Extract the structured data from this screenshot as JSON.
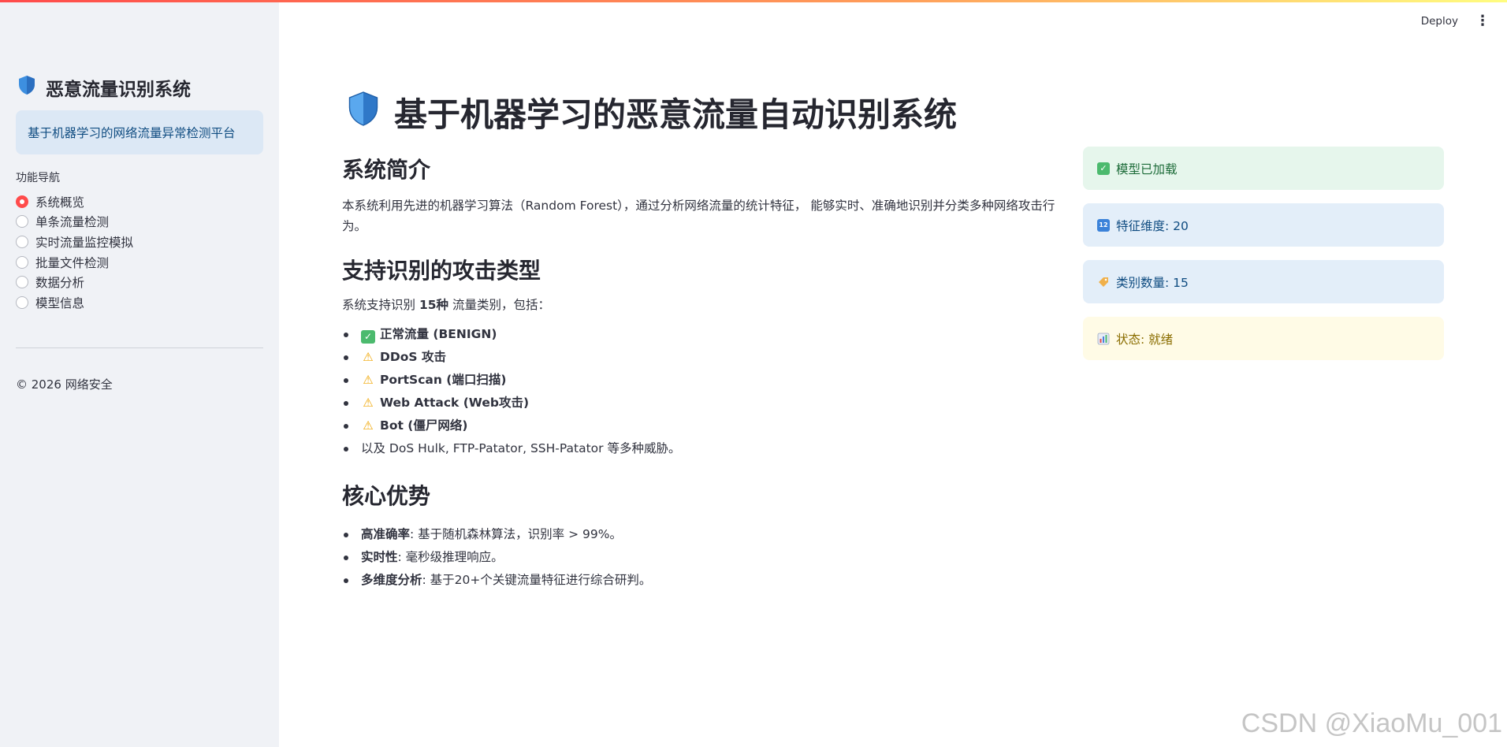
{
  "header": {
    "deploy_label": "Deploy",
    "menu_icon": "kebab-menu-icon"
  },
  "sidebar": {
    "title": "恶意流量识别系统",
    "title_icon": "shield-icon",
    "info_text": "基于机器学习的网络流量异常检测平台",
    "nav_label": "功能导航",
    "nav_items": [
      {
        "label": "系统概览",
        "selected": true
      },
      {
        "label": "单条流量检测",
        "selected": false
      },
      {
        "label": "实时流量监控模拟",
        "selected": false
      },
      {
        "label": "批量文件检测",
        "selected": false
      },
      {
        "label": "数据分析",
        "selected": false
      },
      {
        "label": "模型信息",
        "selected": false
      }
    ],
    "footer": "© 2026 网络安全"
  },
  "main": {
    "title": "基于机器学习的恶意流量自动识别系统",
    "sections": {
      "intro_heading": "系统简介",
      "intro_text": "本系统利用先进的机器学习算法（Random Forest），通过分析网络流量的统计特征， 能够实时、准确地识别并分类多种网络攻击行为。",
      "attack_heading": "支持识别的攻击类型",
      "attack_intro_prefix": "系统支持识别 ",
      "attack_intro_count": "15种",
      "attack_intro_suffix": " 流量类别，包括：",
      "attack_items": [
        {
          "icon": "check-icon",
          "text": "正常流量 (BENIGN)",
          "bold": true
        },
        {
          "icon": "warning-icon",
          "text": "DDoS 攻击",
          "bold": true
        },
        {
          "icon": "warning-icon",
          "text": "PortScan (端口扫描)",
          "bold": true
        },
        {
          "icon": "warning-icon",
          "text": "Web Attack (Web攻击)",
          "bold": true
        },
        {
          "icon": "warning-icon",
          "text": "Bot (僵尸网络)",
          "bold": true
        },
        {
          "icon": "",
          "text": "以及 DoS Hulk, FTP-Patator, SSH-Patator 等多种威胁。",
          "bold": false
        }
      ],
      "advantages_heading": "核心优势",
      "advantages": [
        {
          "term": "高准确率",
          "desc": ": 基于随机森林算法，识别率 > 99%。"
        },
        {
          "term": "实时性",
          "desc": ": 毫秒级推理响应。"
        },
        {
          "term": "多维度分析",
          "desc": ": 基于20+个关键流量特征进行综合研判。"
        }
      ]
    }
  },
  "status_cards": [
    {
      "icon": "check-icon",
      "text": "模型已加载",
      "bg": "#e6f6ec",
      "color": "#1c6b38",
      "icon_bg": "#4cba6e"
    },
    {
      "icon": "numbers-icon",
      "text": "特征维度: 20",
      "bg": "#e3eef9",
      "color": "#0f4c81",
      "icon_bg": "#3b82d9"
    },
    {
      "icon": "tag-icon",
      "text": "类别数量: 15",
      "bg": "#e3eef9",
      "color": "#0f4c81",
      "icon_bg": "#f0b04a"
    },
    {
      "icon": "bar-chart-icon",
      "text": "状态: 就绪",
      "bg": "#fffbe6",
      "color": "#8a6d00",
      "icon_bg": "#7a8fb8"
    }
  ],
  "watermark": "CSDN @XiaoMu_001"
}
